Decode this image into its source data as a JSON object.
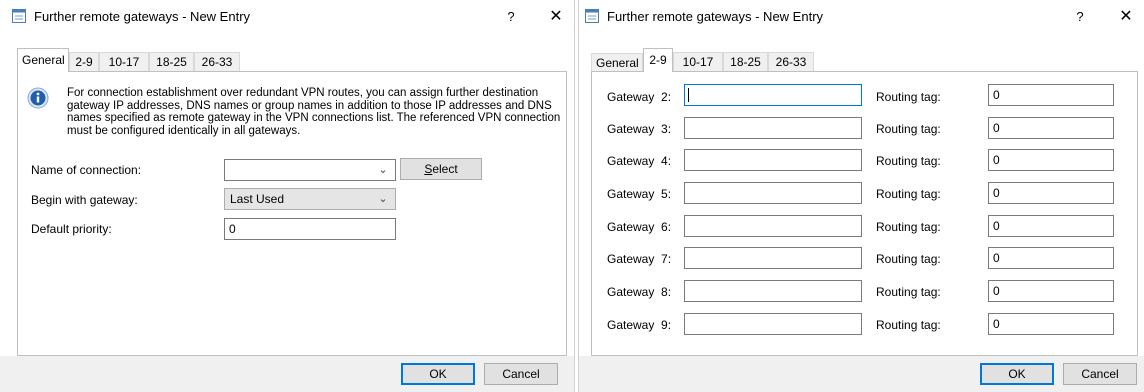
{
  "left": {
    "title": "Further remote gateways - New Entry",
    "help": "?",
    "close": "✕",
    "tabs": [
      "General",
      "2-9",
      "10-17",
      "18-25",
      "26-33"
    ],
    "info_text": "For connection establishment over redundant VPN routes, you can assign further destination gateway IP addresses, DNS names or group names in addition to those IP addresses and DNS names specified as remote gateway in the VPN connections list. The referenced VPN connection must be configured identically in all gateways.",
    "name_label": "Name of connection:",
    "name_value": "",
    "select_label_ul": "S",
    "select_label_rest": "elect",
    "begin_label": "Begin with gateway:",
    "begin_value": "Last Used",
    "priority_label": "Default priority:",
    "priority_value": "0",
    "ok": "OK",
    "cancel": "Cancel"
  },
  "right": {
    "title": "Further remote gateways - New Entry",
    "help": "?",
    "close": "✕",
    "tabs": [
      "General",
      "2-9",
      "10-17",
      "18-25",
      "26-33"
    ],
    "routing_label": "Routing tag:",
    "gateways": [
      {
        "label": "Gateway  2:",
        "value": "",
        "tag": "0"
      },
      {
        "label": "Gateway  3:",
        "value": "",
        "tag": "0"
      },
      {
        "label": "Gateway  4:",
        "value": "",
        "tag": "0"
      },
      {
        "label": "Gateway  5:",
        "value": "",
        "tag": "0"
      },
      {
        "label": "Gateway  6:",
        "value": "",
        "tag": "0"
      },
      {
        "label": "Gateway  7:",
        "value": "",
        "tag": "0"
      },
      {
        "label": "Gateway  8:",
        "value": "",
        "tag": "0"
      },
      {
        "label": "Gateway  9:",
        "value": "",
        "tag": "0"
      }
    ],
    "ok": "OK",
    "cancel": "Cancel"
  },
  "colors": {
    "accent": "#0078d7",
    "info_icon": "#1f5fae",
    "face": "#f0f0f0"
  },
  "icons": {
    "app": "window-icon",
    "info": "info-icon",
    "dropdown": "chevron-down-icon"
  }
}
